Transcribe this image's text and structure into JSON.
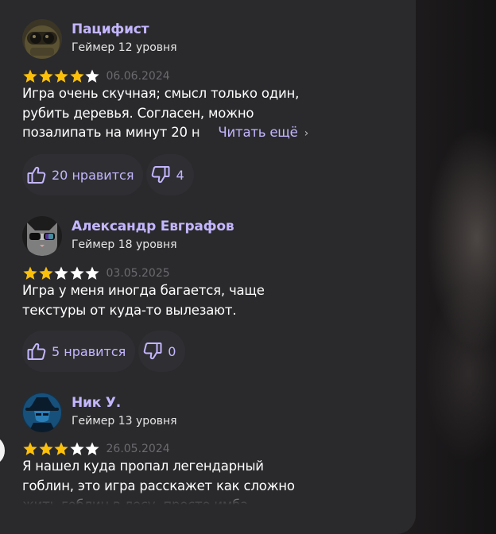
{
  "reviews": [
    {
      "author": "Пацифист",
      "level": "Геймер 12 уровня",
      "rating": 4,
      "max_rating": 5,
      "date": "06.06.2024",
      "text": "Игра очень скучная; смысл только один, рубить деревья. Согласен, можно позалипать на минут 20 н",
      "read_more": "Читать ещё",
      "likes_label": "20 нравится",
      "dislikes": "4",
      "avatar_icon": "goggles-avatar"
    },
    {
      "author": "Александр Евграфов",
      "level": "Геймер 18 уровня",
      "rating": 2,
      "max_rating": 5,
      "date": "03.05.2025",
      "text": "Игра у меня иногда багается, чаще текстуры от куда-то вылезают.",
      "likes_label": "5 нравится",
      "dislikes": "0",
      "avatar_icon": "cat-sunglasses-avatar"
    },
    {
      "author": "Ник У.",
      "level": "Геймер 13 уровня",
      "rating": 3,
      "max_rating": 5,
      "date": "26.05.2024",
      "text": "Я нашел куда пропал легендарный гоблин, это игра расскажет как сложно жить гоблин в лесу, просто имба",
      "avatar_icon": "hooded-hat-avatar"
    }
  ],
  "colors": {
    "panel": "#2a2a2d",
    "accent": "#c4b6ff",
    "star_filled": "#fcc00b",
    "star_empty": "#ffffff",
    "date": "#6b6b6f"
  }
}
